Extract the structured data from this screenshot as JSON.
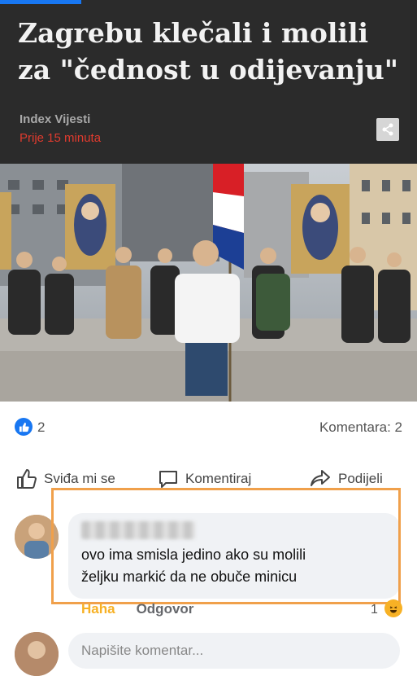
{
  "article": {
    "headline_line1": "Zagrebu klečali i molili",
    "headline_line2": "za \"čednost u odijevanju\"",
    "source": "Index Vijesti",
    "time": "Prije 15 minuta"
  },
  "icons": {
    "share": "share-icon",
    "like_reaction": "thumbs-up-icon",
    "like_action": "like-outline-icon",
    "comment_action": "comment-bubble-icon",
    "share_action": "share-arrow-icon",
    "haha_reaction": "laughing-emoji-icon"
  },
  "stats": {
    "likes": "2",
    "comments": "Komentara: 2"
  },
  "actions": {
    "like": "Sviđa mi se",
    "comment": "Komentiraj",
    "share": "Podijeli"
  },
  "comment": {
    "text_line1": "ovo ima smisla jedino ako su molili",
    "text_line2": "željku markić da ne obuče minicu",
    "haha": "Haha",
    "reply": "Odgovor",
    "reaction_count": "1"
  },
  "composer": {
    "placeholder": "Napišite komentar..."
  },
  "colors": {
    "header_bg": "#2b2b2b",
    "time_red": "#e03b2e",
    "facebook_blue": "#1877f2",
    "highlight_orange": "#f0a04b",
    "haha_yellow": "#f7b125"
  }
}
